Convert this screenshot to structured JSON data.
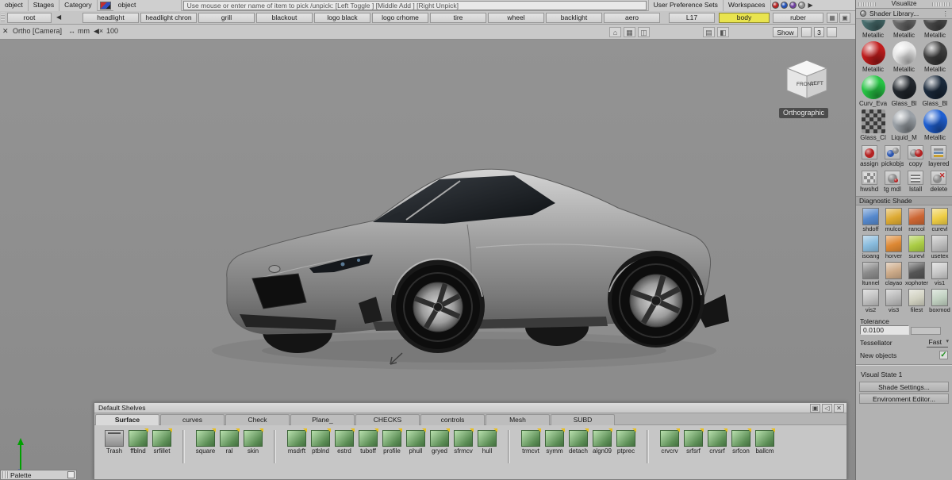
{
  "menubar": {
    "object_cell": "object",
    "stages": "Stages",
    "category": "Category",
    "object_field": "object",
    "prompt": "Use mouse or enter name of item to pick /unpick: [Left Toggle ] [Middle Add ] [Right Unpick]",
    "user_preference_sets": "User Preference Sets",
    "workspaces": "Workspaces"
  },
  "toolbar": {
    "root": "root",
    "buttons": [
      "headlight",
      "headlight chron",
      "grill",
      "blackout",
      "logo black",
      "logo crhome",
      "tire",
      "wheel",
      "backlight",
      "aero"
    ],
    "layer": "L17",
    "body": "body",
    "ruber": "ruber"
  },
  "viewport_header": {
    "camera": "Ortho [Camera]",
    "unit": "mm",
    "zoom": "100",
    "show": "Show",
    "three": "3"
  },
  "viewport": {
    "cube_front": "FRONT",
    "cube_left": "LEFT",
    "projection": "Orthographic"
  },
  "shader_panel": {
    "title": "Visualize",
    "library": "Shader Library...",
    "shaders": [
      {
        "name": "Metallic",
        "color": "#4a7070"
      },
      {
        "name": "Metallic",
        "color": "#6e6e6e"
      },
      {
        "name": "Metallic",
        "color": "#505050"
      },
      {
        "name": "Metallic",
        "color": "#c01d1d"
      },
      {
        "name": "Metallic",
        "color": "#e6e6e6"
      },
      {
        "name": "Metallic",
        "color": "#3f3f3f"
      },
      {
        "name": "Curv_Eva",
        "color": "#27c545"
      },
      {
        "name": "Glass_Bl",
        "color": "#23282e"
      },
      {
        "name": "Glass_Bl",
        "color": "#1b2a3c"
      },
      {
        "name": "Glass_Cl",
        "pattern": "checker"
      },
      {
        "name": "Liquid_M",
        "color": "#9aa0a6"
      },
      {
        "name": "Metallic",
        "color": "#1f5fd0"
      }
    ],
    "tools_row1": [
      "assign",
      "pickobjs",
      "copy",
      "layered"
    ],
    "tools_row2": [
      "hwshd",
      "tg mdl",
      "lstall",
      "delete"
    ],
    "diagnostic_title": "Diagnostic Shade",
    "diag_items": [
      {
        "name": "shdoff",
        "color": "#5588cc"
      },
      {
        "name": "mulcol",
        "color": "#ddaa33"
      },
      {
        "name": "rancol",
        "color": "#cc6633"
      },
      {
        "name": "curevl",
        "color": "#eecc44"
      },
      {
        "name": "isoang",
        "color": "#88bbdd"
      },
      {
        "name": "horver",
        "color": "#dd8833"
      },
      {
        "name": "surevl",
        "color": "#aacc44"
      },
      {
        "name": "usetex",
        "color": "#bbbbbb"
      },
      {
        "name": "ltunnel",
        "color": "#8a8a8a"
      },
      {
        "name": "clayao",
        "color": "#ccaa88"
      },
      {
        "name": "xophoter",
        "color": "#555555"
      },
      {
        "name": "vis1",
        "color": "#c8c8c8"
      },
      {
        "name": "vis2",
        "color": "#c0c0c0"
      },
      {
        "name": "vis3",
        "color": "#b8b8b8"
      },
      {
        "name": "filest",
        "color": "#d0d0c0"
      },
      {
        "name": "boxmod",
        "color": "#c0d0c0"
      }
    ],
    "tolerance_label": "Tolerance",
    "tolerance_value": "0.0100",
    "tessellator_label": "Tessellator",
    "tessellator_value": "Fast",
    "new_objects": "New objects",
    "visual_state": "Visual State 1",
    "shade_settings": "Shade Settings...",
    "environment_editor": "Environment Editor..."
  },
  "shelves": {
    "title": "Default Shelves",
    "active_tab": "Surface",
    "tabs": [
      "Surface",
      "curves",
      "Check",
      "Plane_",
      "CHECKS",
      "controls",
      "Mesh",
      "SUBD"
    ],
    "groups": [
      [
        "Trash",
        "ffblnd",
        "srfillet"
      ],
      [
        "square",
        "ral",
        "skin"
      ],
      [
        "msdrft",
        "ptblnd",
        "estrd",
        "tuboff",
        "profile",
        "phull",
        "gryed",
        "sfrmcv",
        "hull"
      ],
      [
        "trmcvt",
        "symm",
        "detach",
        "algn09",
        "ptprec"
      ],
      [
        "crvcrv",
        "srfsrf",
        "crvsrf",
        "srfcon",
        "ballcm"
      ]
    ]
  },
  "palette": {
    "title": "Palette"
  }
}
